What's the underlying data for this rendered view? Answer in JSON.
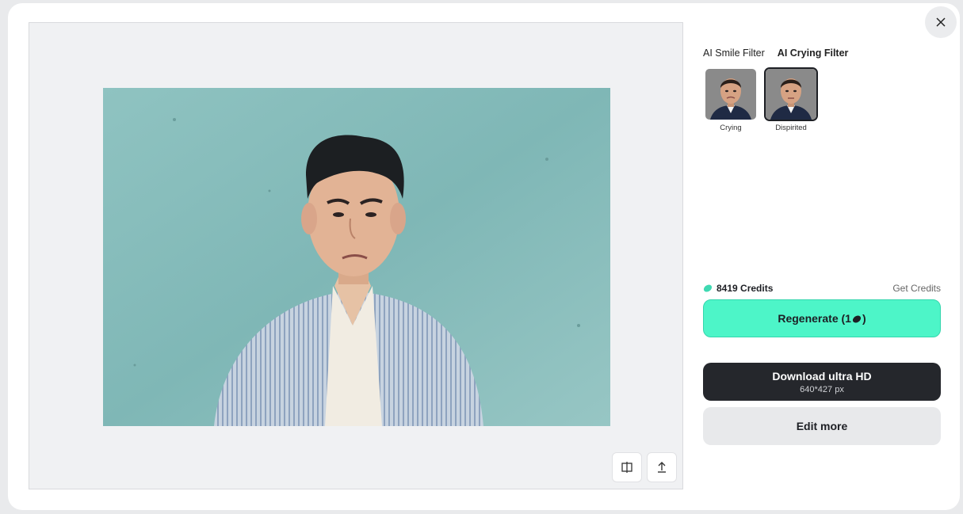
{
  "window": {
    "close_icon": "close-icon"
  },
  "preview": {
    "image_alt": "Edited photo of a man with a sad, crying expression against a teal wall",
    "tools": [
      {
        "icon": "compare-icon"
      },
      {
        "icon": "upload-icon"
      }
    ]
  },
  "filters": {
    "tabs": [
      {
        "label": "AI Smile Filter",
        "active": false
      },
      {
        "label": "AI Crying Filter",
        "active": true
      }
    ],
    "options": [
      {
        "label": "Crying",
        "selected": false
      },
      {
        "label": "Dispirited",
        "selected": true
      }
    ]
  },
  "credits": {
    "icon": "credit-drop-icon",
    "label": "8419 Credits",
    "get_label": "Get Credits"
  },
  "actions": {
    "regenerate_label": "Regenerate (1",
    "regenerate_suffix": ")",
    "download_label": "Download ultra HD",
    "download_size": "640*427 px",
    "edit_label": "Edit more"
  },
  "colors": {
    "accent": "#4df5c8",
    "dark_button": "#25272c",
    "credit_icon": "#3fd9b2"
  }
}
